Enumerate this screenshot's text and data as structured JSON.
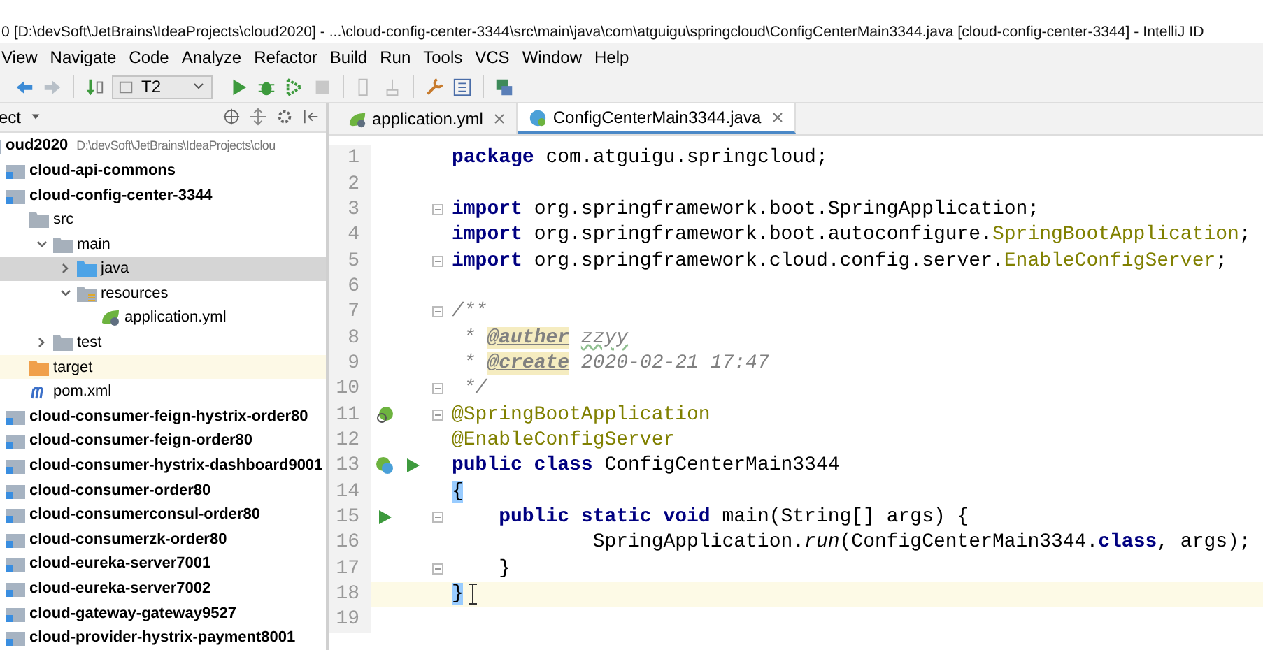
{
  "window": {
    "title": "0 [D:\\devSoft\\JetBrains\\IdeaProjects\\cloud2020] - ...\\cloud-config-center-3344\\src\\main\\java\\com\\atguigu\\springcloud\\ConfigCenterMain3344.java [cloud-config-center-3344] - IntelliJ ID"
  },
  "menu": [
    "View",
    "Navigate",
    "Code",
    "Analyze",
    "Refactor",
    "Build",
    "Run",
    "Tools",
    "VCS",
    "Window",
    "Help"
  ],
  "toolbar": {
    "run_config": "T2"
  },
  "project_panel": {
    "title": "ect",
    "tree": [
      {
        "label": "oud2020",
        "path": "D:\\devSoft\\JetBrains\\IdeaProjects\\clou",
        "kind": "module",
        "selected": false,
        "children": [
          {
            "label": "cloud-api-commons",
            "kind": "module",
            "selected": false
          },
          {
            "label": "cloud-config-center-3344",
            "kind": "module",
            "selected": false,
            "children": [
              {
                "label": "src",
                "kind": "folder",
                "selected": false,
                "children": [
                  {
                    "label": "main",
                    "kind": "folder",
                    "expanded": true,
                    "selected": false,
                    "children": [
                      {
                        "label": "java",
                        "kind": "source-folder",
                        "expanded": false,
                        "selected": true
                      },
                      {
                        "label": "resources",
                        "kind": "resource-folder",
                        "expanded": true,
                        "selected": false,
                        "children": [
                          {
                            "label": "application.yml",
                            "kind": "yml",
                            "selected": false
                          }
                        ]
                      }
                    ]
                  },
                  {
                    "label": "test",
                    "kind": "folder",
                    "expanded": false,
                    "selected": false
                  }
                ]
              },
              {
                "label": "target",
                "kind": "excluded-folder",
                "selected": false
              },
              {
                "label": "pom.xml",
                "kind": "pom",
                "selected": false
              }
            ]
          },
          {
            "label": "cloud-consumer-feign-hystrix-order80",
            "kind": "module",
            "selected": false
          },
          {
            "label": "cloud-consumer-feign-order80",
            "kind": "module",
            "selected": false
          },
          {
            "label": "cloud-consumer-hystrix-dashboard9001",
            "kind": "module",
            "selected": false
          },
          {
            "label": "cloud-consumer-order80",
            "kind": "module",
            "selected": false
          },
          {
            "label": "cloud-consumerconsul-order80",
            "kind": "module",
            "selected": false
          },
          {
            "label": "cloud-consumerzk-order80",
            "kind": "module",
            "selected": false
          },
          {
            "label": "cloud-eureka-server7001",
            "kind": "module",
            "selected": false
          },
          {
            "label": "cloud-eureka-server7002",
            "kind": "module",
            "selected": false
          },
          {
            "label": "cloud-gateway-gateway9527",
            "kind": "module",
            "selected": false
          },
          {
            "label": "cloud-provider-hystrix-payment8001",
            "kind": "module",
            "selected": false
          }
        ]
      }
    ]
  },
  "tabs": [
    {
      "label": "application.yml",
      "kind": "yml",
      "selected": false
    },
    {
      "label": "ConfigCenterMain3344.java",
      "kind": "java",
      "selected": true
    }
  ],
  "editor": {
    "lines": [
      {
        "number": "1",
        "current": false,
        "tokens": [
          {
            "kind": "keyword",
            "text": "package"
          },
          {
            "kind": "plain",
            "text": " com.atguigu.springcloud;"
          }
        ]
      },
      {
        "number": "2",
        "current": false
      },
      {
        "number": "3",
        "current": false,
        "fold": true,
        "tokens": [
          {
            "kind": "keyword",
            "text": "import"
          },
          {
            "kind": "plain",
            "text": " org.springframework.boot.SpringApplication;"
          }
        ]
      },
      {
        "number": "4",
        "current": false,
        "tokens": [
          {
            "kind": "keyword",
            "text": "import"
          },
          {
            "kind": "plain",
            "text": " org.springframework.boot.autoconfigure."
          },
          {
            "kind": "annotation",
            "text": "SpringBootApplication"
          },
          {
            "kind": "plain",
            "text": ";"
          }
        ]
      },
      {
        "number": "5",
        "current": false,
        "fold": true,
        "tokens": [
          {
            "kind": "keyword",
            "text": "import"
          },
          {
            "kind": "plain",
            "text": " org.springframework.cloud.config.server."
          },
          {
            "kind": "annotation",
            "text": "EnableConfigServer"
          },
          {
            "kind": "plain",
            "text": ";"
          }
        ]
      },
      {
        "number": "6",
        "current": false
      },
      {
        "number": "7",
        "current": false,
        "fold": true,
        "tokens": [
          {
            "kind": "comment",
            "text": "/**"
          }
        ]
      },
      {
        "number": "8",
        "current": false,
        "tokens": [
          {
            "kind": "comment",
            "text": " * "
          },
          {
            "kind": "doctag",
            "text": "@auther"
          },
          {
            "kind": "typo",
            "text": "zzyy"
          }
        ]
      },
      {
        "number": "9",
        "current": false,
        "tokens": [
          {
            "kind": "comment",
            "text": " * "
          },
          {
            "kind": "doctag",
            "text": "@create"
          },
          {
            "kind": "comment",
            "text": " 2020-02-21 17:47"
          }
        ]
      },
      {
        "number": "10",
        "current": false,
        "fold": true,
        "tokens": [
          {
            "kind": "comment",
            "text": " */"
          }
        ]
      },
      {
        "number": "11",
        "current": false,
        "fold": true,
        "gutter_icons": [
          {
            "kind": "bean"
          }
        ],
        "tokens": [
          {
            "kind": "annotation",
            "text": "@SpringBootApplication"
          }
        ]
      },
      {
        "number": "12",
        "current": false,
        "tokens": [
          {
            "kind": "annotation",
            "text": "@EnableConfigServer"
          }
        ]
      },
      {
        "number": "13",
        "current": false,
        "gutter_icons": [
          {
            "kind": "class-bean"
          },
          {
            "kind": "run"
          }
        ],
        "tokens": [
          {
            "kind": "keyword",
            "text": "public class"
          },
          {
            "kind": "plain",
            "text": " ConfigCenterMain3344"
          }
        ]
      },
      {
        "number": "14",
        "current": false,
        "tokens": [
          {
            "kind": "brace",
            "text": "{"
          }
        ]
      },
      {
        "number": "15",
        "current": false,
        "fold": true,
        "gutter_icons": [
          {
            "kind": "run"
          }
        ],
        "tokens": [
          {
            "kind": "keyword",
            "text": "    public static void"
          },
          {
            "kind": "plain",
            "text": " main(String[] args) {"
          }
        ]
      },
      {
        "number": "16",
        "current": false,
        "tokens": [
          {
            "kind": "plain",
            "text": "            SpringApplication."
          },
          {
            "kind": "italic",
            "text": "run"
          },
          {
            "kind": "plain",
            "text": "(ConfigCenterMain3344."
          },
          {
            "kind": "keyword",
            "text": "class"
          },
          {
            "kind": "plain",
            "text": ", args);"
          }
        ]
      },
      {
        "number": "17",
        "current": false,
        "fold": true,
        "tokens": [
          {
            "kind": "plain",
            "text": "    }"
          }
        ]
      },
      {
        "number": "18",
        "current": true,
        "cursor": true,
        "tokens": [
          {
            "kind": "brace",
            "text": "}"
          }
        ]
      },
      {
        "number": "19",
        "current": false
      }
    ]
  }
}
